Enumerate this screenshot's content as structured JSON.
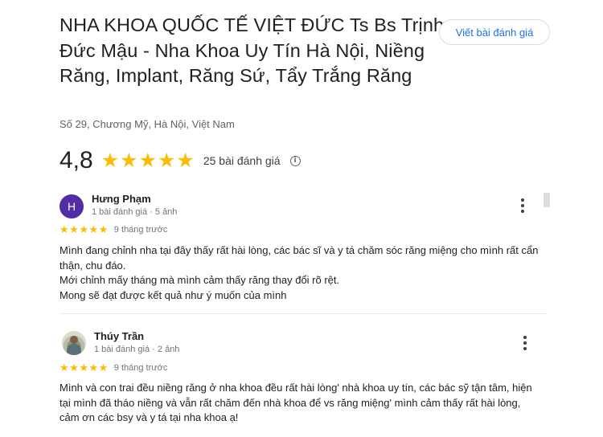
{
  "place": {
    "title": "NHA KHOA QUỐC TẾ VIỆT ĐỨC Ts Bs Trịnh Đức Mậu - Nha Khoa Uy Tín Hà Nội, Niềng Răng, Implant, Răng Sứ, Tẩy Trắng Răng",
    "address": "Số 29, Chương Mỹ, Hà Nội, Việt Nam",
    "write_review_label": "Viết bài đánh giá",
    "rating": "4,8",
    "rating_stars": 5,
    "review_count": "25 bài đánh giá",
    "info_icon": "info-icon",
    "star_color": "#fbbc04",
    "accent_color": "#1a73e8"
  },
  "reviews": [
    {
      "avatar_letter": "H",
      "avatar_color": "#512da8",
      "name": "Hưng Phạm",
      "meta": "1 bài đánh giá · 5 ảnh",
      "stars": 5,
      "time": "9 tháng trước",
      "text_lines": [
        "Mình đang chỉnh nha tại đây thấy rất hài lòng, các bác sĩ và y tá chăm sóc răng miệng cho mình rất cẩn thận, chu đáo.",
        "Mới chỉnh mấy tháng mà mình cảm thấy răng thay đổi rõ rệt.",
        "Mong sẽ đạt được kết quả như ý muốn của mình"
      ]
    },
    {
      "avatar_letter": "",
      "avatar_color": "",
      "name": "Thúy Trần",
      "meta": "1 bài đánh giá · 2 ảnh",
      "stars": 5,
      "time": "9 tháng trước",
      "text_lines": [
        "Mình và con trai đều niềng răng ở nha khoa đều rất hài lòng' nhà khoa uy tín, các bác sỹ tận tâm, hiện tại mình đã tháo niềng và vẫn rất chăm đến nhà khoa để vs răng miệng' mình cảm thấy rất hài lòng, cảm ơn các bsy và y tá tại nha khoa ạ!"
      ]
    }
  ]
}
